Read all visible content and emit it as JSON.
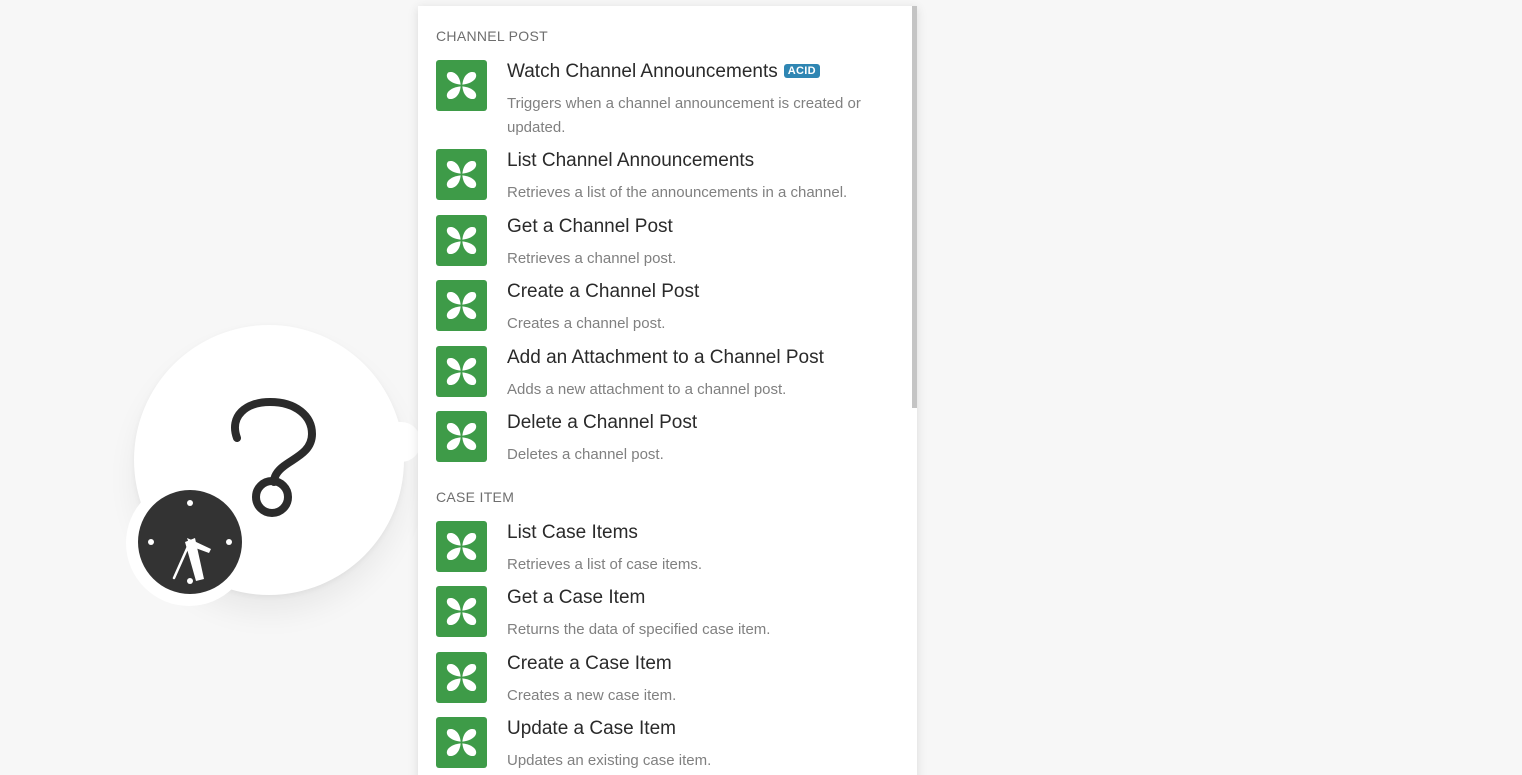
{
  "sections": [
    {
      "header": "CHANNEL POST",
      "items": [
        {
          "title": "Watch Channel Announcements",
          "badge": "ACID",
          "description": "Triggers when a channel announcement is created or updated."
        },
        {
          "title": "List Channel Announcements",
          "description": "Retrieves a list of the announcements in a channel."
        },
        {
          "title": "Get a Channel Post",
          "description": "Retrieves a channel post."
        },
        {
          "title": "Create a Channel Post",
          "description": "Creates a channel post."
        },
        {
          "title": "Add an Attachment to a Channel Post",
          "description": "Adds a new attachment to a channel post."
        },
        {
          "title": "Delete a Channel Post",
          "description": "Deletes a channel post."
        }
      ]
    },
    {
      "header": "CASE ITEM",
      "items": [
        {
          "title": "List Case Items",
          "description": "Retrieves a list of case items."
        },
        {
          "title": "Get a Case Item",
          "description": "Returns the data of specified case item."
        },
        {
          "title": "Create a Case Item",
          "description": "Creates a new case item."
        },
        {
          "title": "Update a Case Item",
          "description": "Updates an existing case item."
        }
      ]
    }
  ],
  "icons": {
    "app": "butterfly-icon",
    "module": "question-mark-icon",
    "trigger": "clock-icon"
  },
  "colors": {
    "app_icon_bg": "#3e9b48",
    "badge_bg": "#2f86b3"
  }
}
